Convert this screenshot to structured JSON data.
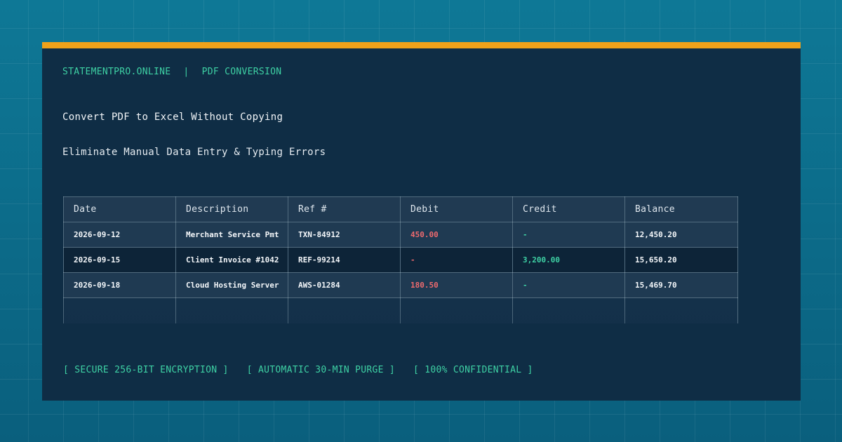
{
  "brand": {
    "site": "STATEMENTPRO.ONLINE",
    "separator": "|",
    "section": "PDF CONVERSION"
  },
  "headline": "Convert PDF to Excel Without Copying",
  "subline": "Eliminate Manual Data Entry & Typing Errors",
  "table": {
    "headers": [
      "Date",
      "Description",
      "Ref #",
      "Debit",
      "Credit",
      "Balance"
    ],
    "rows": [
      [
        "2026-09-12",
        "Merchant Service Pmt",
        "TXN-84912",
        "450.00",
        "-",
        "12,450.20"
      ],
      [
        "2026-09-15",
        "Client Invoice #1042",
        "REF-99214",
        "-",
        "3,200.00",
        "15,650.20"
      ],
      [
        "2026-09-18",
        "Cloud Hosting Server",
        "AWS-01284",
        "180.50",
        "-",
        "15,469.70"
      ],
      [
        "",
        "",
        "",
        "",
        "",
        ""
      ]
    ]
  },
  "badges": [
    "[ SECURE 256-BIT ENCRYPTION ]",
    "[ AUTOMATIC 30-MIN PURGE ]",
    "[ 100% CONFIDENTIAL ]"
  ],
  "colors": {
    "accent": "#f0a21a",
    "brand_green": "#3ed1a4",
    "debit_red": "#ee6a6e",
    "card_bg": "#0f2d45",
    "page_bg": "#0b6a8a"
  }
}
